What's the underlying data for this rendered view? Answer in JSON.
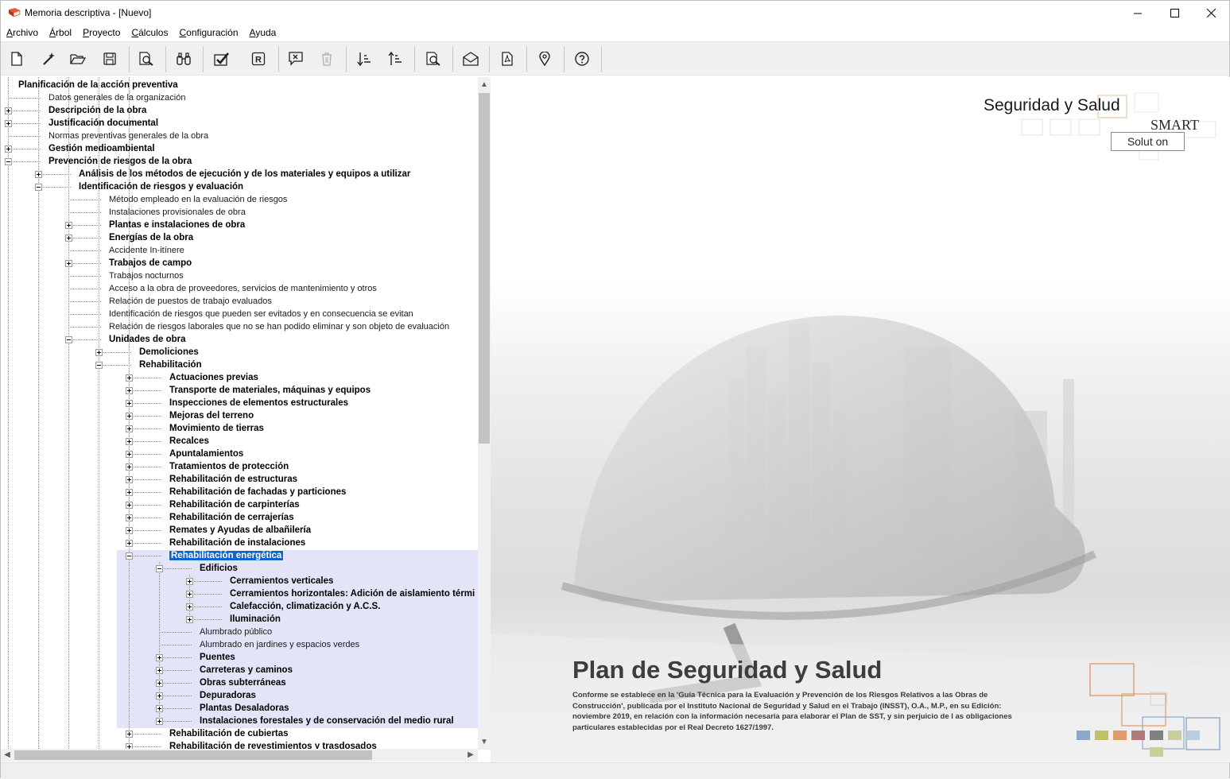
{
  "window": {
    "title": "Memoria descriptiva - [Nuevo]",
    "minimize_icon": "minimize-icon",
    "maximize_icon": "maximize-icon",
    "close_icon": "close-icon"
  },
  "menu": [
    {
      "label": "Archivo",
      "ul": "A",
      "rest": "rchivo"
    },
    {
      "label": "Árbol",
      "ul": "Á",
      "rest": "rbol"
    },
    {
      "label": "Proyecto",
      "ul": "P",
      "rest": "royecto"
    },
    {
      "label": "Cálculos",
      "ul": "C",
      "rest": "álculos"
    },
    {
      "label": "Configuración",
      "ul": "C",
      "rest": "onfiguración"
    },
    {
      "label": "Ayuda",
      "ul": "A",
      "rest": "yuda"
    }
  ],
  "toolbar": [
    "new-document-icon",
    "wizard-wand-icon",
    "open-folder-icon",
    "save-icon",
    "print-preview-icon",
    "find-binoculars-icon",
    "check-icon",
    "registered-icon",
    "comment-x-icon",
    "trash-icon",
    "sort-ascending-icon",
    "sort-descending-icon",
    "document-search-icon",
    "open-envelope-icon",
    "pdf-icon",
    "location-pin-icon",
    "help-icon"
  ],
  "tree": {
    "root": "Planificación de la acción preventiva",
    "rows": [
      {
        "label": "Datos generales de la organización",
        "level": 1,
        "bold": false,
        "exp": "none"
      },
      {
        "label": "Descripción de la obra",
        "level": 1,
        "bold": true,
        "exp": "plus"
      },
      {
        "label": "Justificación documental",
        "level": 1,
        "bold": true,
        "exp": "plus"
      },
      {
        "label": "Normas preventivas generales de la obra",
        "level": 1,
        "bold": false,
        "exp": "none"
      },
      {
        "label": "Gestión medioambiental",
        "level": 1,
        "bold": true,
        "exp": "plus"
      },
      {
        "label": "Prevención de riesgos de la obra",
        "level": 1,
        "bold": true,
        "exp": "minus"
      },
      {
        "label": "Análisis de los métodos de ejecución y de los materiales y equipos a utilizar",
        "level": 2,
        "bold": true,
        "exp": "plus"
      },
      {
        "label": "Identificación de riesgos y evaluación",
        "level": 2,
        "bold": true,
        "exp": "minus"
      },
      {
        "label": "Método empleado en la evaluación de riesgos",
        "level": 3,
        "bold": false,
        "exp": "none"
      },
      {
        "label": "Instalaciones provisionales de obra",
        "level": 3,
        "bold": false,
        "exp": "none"
      },
      {
        "label": "Plantas e instalaciones de obra",
        "level": 3,
        "bold": true,
        "exp": "plus"
      },
      {
        "label": "Energías de la obra",
        "level": 3,
        "bold": true,
        "exp": "plus"
      },
      {
        "label": "Accidente In-itínere",
        "level": 3,
        "bold": false,
        "exp": "none"
      },
      {
        "label": "Trabajos de campo",
        "level": 3,
        "bold": true,
        "exp": "plus"
      },
      {
        "label": "Trabajos nocturnos",
        "level": 3,
        "bold": false,
        "exp": "none"
      },
      {
        "label": "Acceso a la obra de proveedores, servicios de mantenimiento y otros",
        "level": 3,
        "bold": false,
        "exp": "none"
      },
      {
        "label": "Relación de puestos de trabajo evaluados",
        "level": 3,
        "bold": false,
        "exp": "none"
      },
      {
        "label": "Identificación de riesgos que pueden ser evitados y en consecuencia se evitan",
        "level": 3,
        "bold": false,
        "exp": "none"
      },
      {
        "label": "Relación de riesgos laborales que no se han podido eliminar y son objeto de evaluación",
        "level": 3,
        "bold": false,
        "exp": "none"
      },
      {
        "label": "Unidades de obra",
        "level": 3,
        "bold": true,
        "exp": "minus"
      },
      {
        "label": "Demoliciones",
        "level": 4,
        "bold": true,
        "exp": "plus"
      },
      {
        "label": "Rehabilitación",
        "level": 4,
        "bold": true,
        "exp": "minus"
      },
      {
        "label": "Actuaciones previas",
        "level": 5,
        "bold": true,
        "exp": "plus"
      },
      {
        "label": "Transporte de materiales, máquinas y equipos",
        "level": 5,
        "bold": true,
        "exp": "plus"
      },
      {
        "label": "Inspecciones de elementos estructurales",
        "level": 5,
        "bold": true,
        "exp": "plus"
      },
      {
        "label": "Mejoras del terreno",
        "level": 5,
        "bold": true,
        "exp": "plus"
      },
      {
        "label": "Movimiento de tierras",
        "level": 5,
        "bold": true,
        "exp": "plus"
      },
      {
        "label": "Recalces",
        "level": 5,
        "bold": true,
        "exp": "plus"
      },
      {
        "label": "Apuntalamientos",
        "level": 5,
        "bold": true,
        "exp": "plus"
      },
      {
        "label": "Tratamientos de protección",
        "level": 5,
        "bold": true,
        "exp": "plus"
      },
      {
        "label": "Rehabilitación de estructuras",
        "level": 5,
        "bold": true,
        "exp": "plus"
      },
      {
        "label": "Rehabilitación de fachadas y particiones",
        "level": 5,
        "bold": true,
        "exp": "plus"
      },
      {
        "label": "Rehabilitación de carpinterías",
        "level": 5,
        "bold": true,
        "exp": "plus"
      },
      {
        "label": "Rehabilitación de cerrajerías",
        "level": 5,
        "bold": true,
        "exp": "plus"
      },
      {
        "label": "Remates y Ayudas de albañilería",
        "level": 5,
        "bold": true,
        "exp": "plus"
      },
      {
        "label": "Rehabilitación de instalaciones",
        "level": 5,
        "bold": true,
        "exp": "plus"
      },
      {
        "label": "Rehabilitación energética",
        "level": 5,
        "bold": true,
        "exp": "minus",
        "selected": true
      },
      {
        "label": "Edificios",
        "level": 6,
        "bold": true,
        "exp": "minus"
      },
      {
        "label": "Cerramientos verticales",
        "level": 7,
        "bold": true,
        "exp": "plus"
      },
      {
        "label": "Cerramientos horizontales: Adición de aislamiento térmi",
        "level": 7,
        "bold": true,
        "exp": "plus"
      },
      {
        "label": "Calefacción, climatización y A.C.S.",
        "level": 7,
        "bold": true,
        "exp": "plus"
      },
      {
        "label": "Iluminación",
        "level": 7,
        "bold": true,
        "exp": "plus"
      },
      {
        "label": "Alumbrado público",
        "level": 6,
        "bold": false,
        "exp": "none"
      },
      {
        "label": "Alumbrado en jardines y espacios verdes",
        "level": 6,
        "bold": false,
        "exp": "none"
      },
      {
        "label": "Puentes",
        "level": 6,
        "bold": true,
        "exp": "plus"
      },
      {
        "label": "Carreteras y caminos",
        "level": 6,
        "bold": true,
        "exp": "plus"
      },
      {
        "label": "Obras subterráneas",
        "level": 6,
        "bold": true,
        "exp": "plus"
      },
      {
        "label": "Depuradoras",
        "level": 6,
        "bold": true,
        "exp": "plus"
      },
      {
        "label": "Plantas Desaladoras",
        "level": 6,
        "bold": true,
        "exp": "plus"
      },
      {
        "label": "Instalaciones forestales y de conservación del medio rural",
        "level": 6,
        "bold": true,
        "exp": "plus"
      },
      {
        "label": "Rehabilitación de cubiertas",
        "level": 5,
        "bold": true,
        "exp": "plus"
      },
      {
        "label": "Rehabilitación de revestimientos y trasdosados",
        "level": 5,
        "bold": true,
        "exp": "plus"
      }
    ]
  },
  "splash": {
    "brand_title": "Seguridad y Salud",
    "brand_smart": "SMART",
    "brand_solution": "Solut on",
    "plan_title": "Plan de Seguridad y Salud",
    "plan_desc": "Conforme se establece en la 'Guía Técnica para la Evaluación y Prevención de los Riesgos Relativos a las Obras de Construcción', publicada por el Instituto Nacional de Seguridad y Salud en el Trabajo (INSST), O.A., M.P., en su Edición: noviembre 2019, en relación con la información necesaria para elaborar el Plan de SST, y sin perjuicio de l as obligaciones particulares establecidas por el Real Decreto 1627/1997.",
    "colors": {
      "orange": "#e39a6a",
      "steel_blue": "#8ea9c8",
      "olive": "#c3c06a",
      "salmon": "#e08a6e",
      "mauve": "#b07a7a",
      "slate": "#808080",
      "sage": "#c8cf9a",
      "pale_blue": "#b9cde0"
    }
  },
  "colors": {
    "selection_band": "#e4e4f9",
    "selected_item": "#0a64d2",
    "toolbar_bg": "#f0f0f0"
  }
}
